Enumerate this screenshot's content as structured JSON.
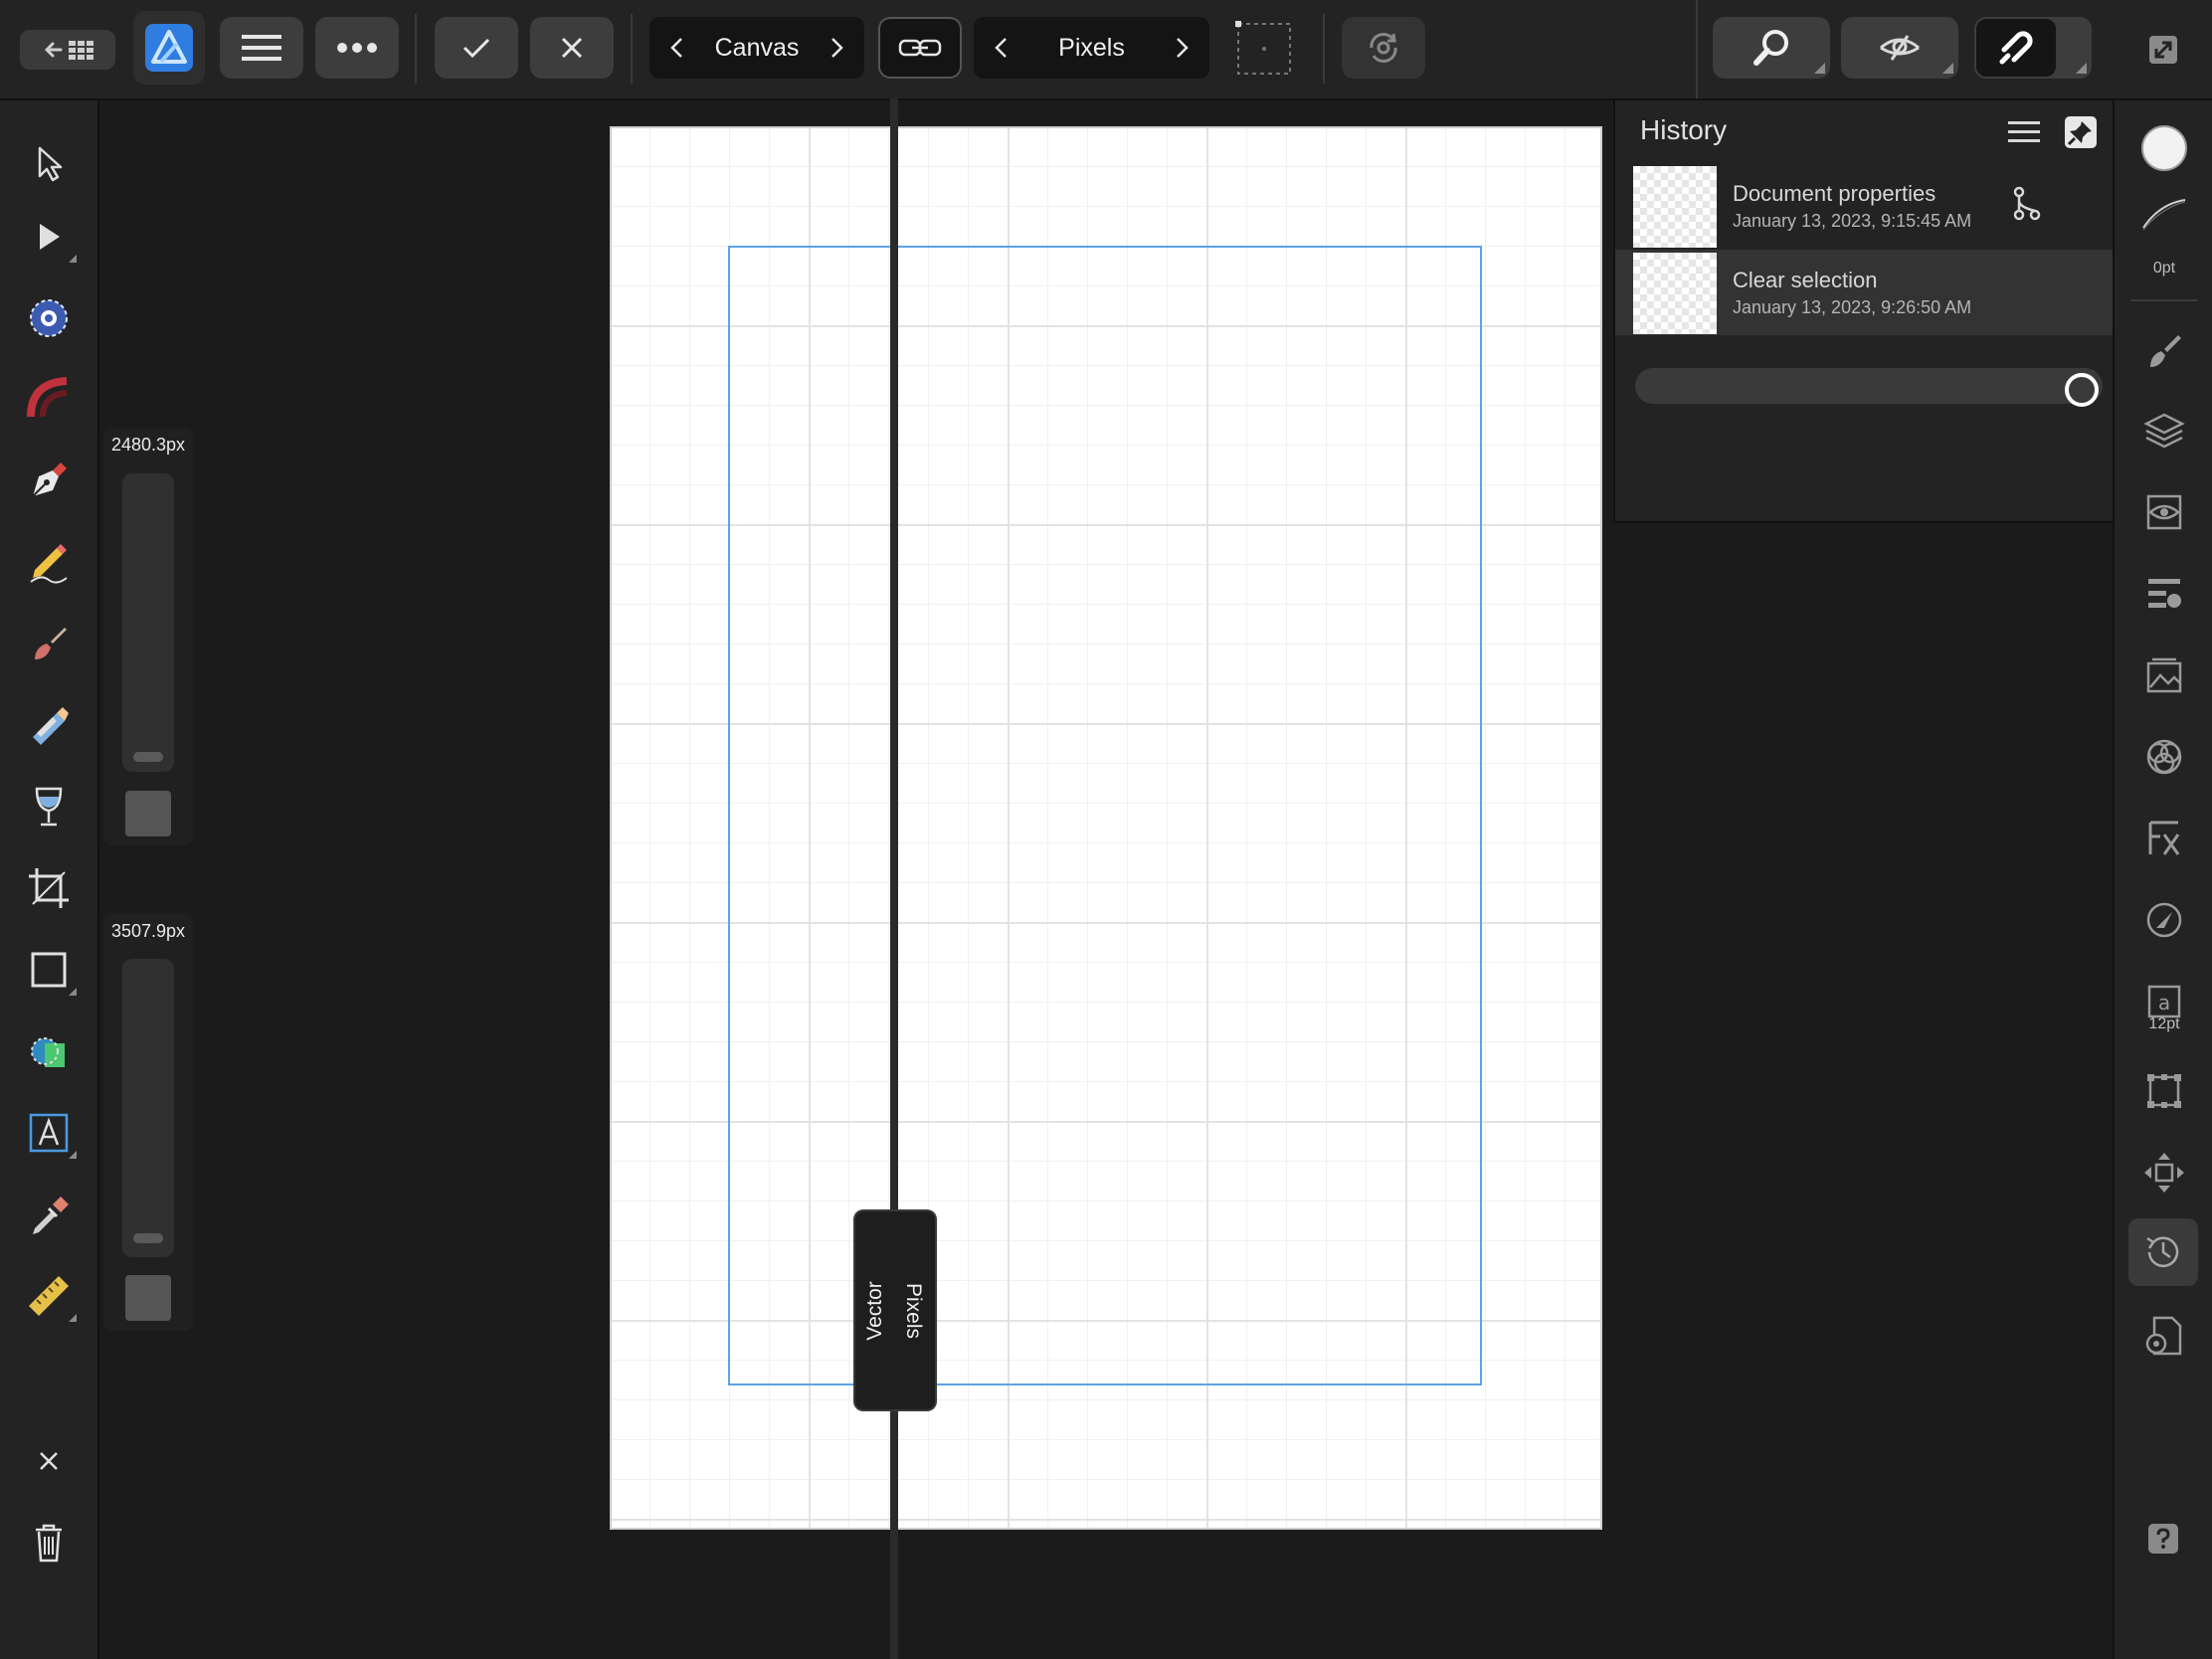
{
  "toolbar": {
    "context_selector": "Canvas",
    "units_selector": "Pixels"
  },
  "brush": {
    "width_value": "2480.3px",
    "height_value": "3507.9px"
  },
  "split_view": {
    "left_label": "Vector",
    "right_label": "Pixels"
  },
  "history": {
    "title": "History",
    "entries": [
      {
        "title": "Document properties",
        "date": "January 13, 2023, 9:15:45 AM"
      },
      {
        "title": "Clear selection",
        "date": "January 13, 2023, 9:26:50 AM"
      }
    ],
    "slider_position": 1.0
  },
  "studio": {
    "stroke_width": "0pt",
    "text_size": "12pt"
  },
  "colors": {
    "accent": "#5ea2e6",
    "background": "#1b1b1b",
    "panel": "#232323"
  }
}
